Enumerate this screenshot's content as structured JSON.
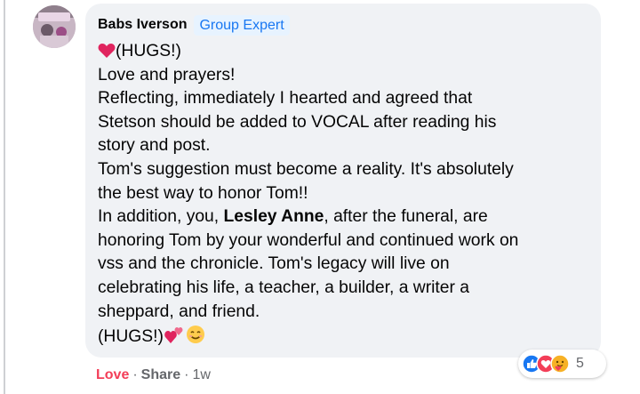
{
  "comment": {
    "author": "Babs Iverson",
    "badge": "Group Expert",
    "lines": {
      "l1": "(HUGS!)",
      "l2": "Love and prayers!",
      "l3": "Reflecting, immediately I hearted and agreed that",
      "l4": "Stetson should be added to VOCAL after reading his",
      "l5": "story and post.",
      "l6": "Tom's suggestion must become a reality. It's absolutely",
      "l7": "the best way to honor Tom!!",
      "l8_pre": "In addition, you, ",
      "l8_bold": "Lesley Anne",
      "l8_post": ", after the funeral, are",
      "l9": "honoring Tom by your wonderful and continued work on",
      "l10": "vss and the chronicle. Tom's legacy will live on",
      "l11": "celebrating his life, a teacher, a builder, a writer a",
      "l12": "sheppard, and friend.",
      "l13": "(HUGS!)"
    }
  },
  "reactions": {
    "icons": [
      "like-icon",
      "love-icon",
      "care-icon"
    ],
    "count": "5"
  },
  "actions": {
    "love_label": "Love",
    "share_label": "Share",
    "separator": "·",
    "time": "1w"
  },
  "colors": {
    "bubble": "#f0f2f5",
    "badge_bg": "#e7f3ff",
    "badge_text": "#1877f2",
    "love": "#f33e58",
    "meta": "#65676b"
  }
}
